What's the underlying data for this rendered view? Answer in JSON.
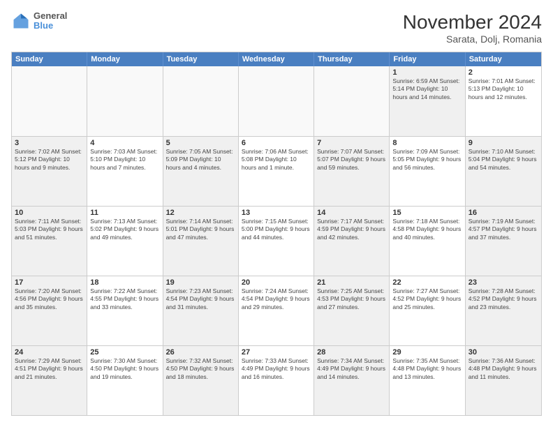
{
  "header": {
    "logo_general": "General",
    "logo_blue": "Blue",
    "title": "November 2024",
    "subtitle": "Sarata, Dolj, Romania"
  },
  "days_of_week": [
    "Sunday",
    "Monday",
    "Tuesday",
    "Wednesday",
    "Thursday",
    "Friday",
    "Saturday"
  ],
  "weeks": [
    [
      {
        "day": "",
        "info": "",
        "empty": true
      },
      {
        "day": "",
        "info": "",
        "empty": true
      },
      {
        "day": "",
        "info": "",
        "empty": true
      },
      {
        "day": "",
        "info": "",
        "empty": true
      },
      {
        "day": "",
        "info": "",
        "empty": true
      },
      {
        "day": "1",
        "info": "Sunrise: 6:59 AM\nSunset: 5:14 PM\nDaylight: 10 hours and 14 minutes.",
        "shaded": true
      },
      {
        "day": "2",
        "info": "Sunrise: 7:01 AM\nSunset: 5:13 PM\nDaylight: 10 hours and 12 minutes.",
        "shaded": false
      }
    ],
    [
      {
        "day": "3",
        "info": "Sunrise: 7:02 AM\nSunset: 5:12 PM\nDaylight: 10 hours and 9 minutes.",
        "shaded": true
      },
      {
        "day": "4",
        "info": "Sunrise: 7:03 AM\nSunset: 5:10 PM\nDaylight: 10 hours and 7 minutes.",
        "shaded": false
      },
      {
        "day": "5",
        "info": "Sunrise: 7:05 AM\nSunset: 5:09 PM\nDaylight: 10 hours and 4 minutes.",
        "shaded": true
      },
      {
        "day": "6",
        "info": "Sunrise: 7:06 AM\nSunset: 5:08 PM\nDaylight: 10 hours and 1 minute.",
        "shaded": false
      },
      {
        "day": "7",
        "info": "Sunrise: 7:07 AM\nSunset: 5:07 PM\nDaylight: 9 hours and 59 minutes.",
        "shaded": true
      },
      {
        "day": "8",
        "info": "Sunrise: 7:09 AM\nSunset: 5:05 PM\nDaylight: 9 hours and 56 minutes.",
        "shaded": false
      },
      {
        "day": "9",
        "info": "Sunrise: 7:10 AM\nSunset: 5:04 PM\nDaylight: 9 hours and 54 minutes.",
        "shaded": true
      }
    ],
    [
      {
        "day": "10",
        "info": "Sunrise: 7:11 AM\nSunset: 5:03 PM\nDaylight: 9 hours and 51 minutes.",
        "shaded": true
      },
      {
        "day": "11",
        "info": "Sunrise: 7:13 AM\nSunset: 5:02 PM\nDaylight: 9 hours and 49 minutes.",
        "shaded": false
      },
      {
        "day": "12",
        "info": "Sunrise: 7:14 AM\nSunset: 5:01 PM\nDaylight: 9 hours and 47 minutes.",
        "shaded": true
      },
      {
        "day": "13",
        "info": "Sunrise: 7:15 AM\nSunset: 5:00 PM\nDaylight: 9 hours and 44 minutes.",
        "shaded": false
      },
      {
        "day": "14",
        "info": "Sunrise: 7:17 AM\nSunset: 4:59 PM\nDaylight: 9 hours and 42 minutes.",
        "shaded": true
      },
      {
        "day": "15",
        "info": "Sunrise: 7:18 AM\nSunset: 4:58 PM\nDaylight: 9 hours and 40 minutes.",
        "shaded": false
      },
      {
        "day": "16",
        "info": "Sunrise: 7:19 AM\nSunset: 4:57 PM\nDaylight: 9 hours and 37 minutes.",
        "shaded": true
      }
    ],
    [
      {
        "day": "17",
        "info": "Sunrise: 7:20 AM\nSunset: 4:56 PM\nDaylight: 9 hours and 35 minutes.",
        "shaded": true
      },
      {
        "day": "18",
        "info": "Sunrise: 7:22 AM\nSunset: 4:55 PM\nDaylight: 9 hours and 33 minutes.",
        "shaded": false
      },
      {
        "day": "19",
        "info": "Sunrise: 7:23 AM\nSunset: 4:54 PM\nDaylight: 9 hours and 31 minutes.",
        "shaded": true
      },
      {
        "day": "20",
        "info": "Sunrise: 7:24 AM\nSunset: 4:54 PM\nDaylight: 9 hours and 29 minutes.",
        "shaded": false
      },
      {
        "day": "21",
        "info": "Sunrise: 7:25 AM\nSunset: 4:53 PM\nDaylight: 9 hours and 27 minutes.",
        "shaded": true
      },
      {
        "day": "22",
        "info": "Sunrise: 7:27 AM\nSunset: 4:52 PM\nDaylight: 9 hours and 25 minutes.",
        "shaded": false
      },
      {
        "day": "23",
        "info": "Sunrise: 7:28 AM\nSunset: 4:52 PM\nDaylight: 9 hours and 23 minutes.",
        "shaded": true
      }
    ],
    [
      {
        "day": "24",
        "info": "Sunrise: 7:29 AM\nSunset: 4:51 PM\nDaylight: 9 hours and 21 minutes.",
        "shaded": true
      },
      {
        "day": "25",
        "info": "Sunrise: 7:30 AM\nSunset: 4:50 PM\nDaylight: 9 hours and 19 minutes.",
        "shaded": false
      },
      {
        "day": "26",
        "info": "Sunrise: 7:32 AM\nSunset: 4:50 PM\nDaylight: 9 hours and 18 minutes.",
        "shaded": true
      },
      {
        "day": "27",
        "info": "Sunrise: 7:33 AM\nSunset: 4:49 PM\nDaylight: 9 hours and 16 minutes.",
        "shaded": false
      },
      {
        "day": "28",
        "info": "Sunrise: 7:34 AM\nSunset: 4:49 PM\nDaylight: 9 hours and 14 minutes.",
        "shaded": true
      },
      {
        "day": "29",
        "info": "Sunrise: 7:35 AM\nSunset: 4:48 PM\nDaylight: 9 hours and 13 minutes.",
        "shaded": false
      },
      {
        "day": "30",
        "info": "Sunrise: 7:36 AM\nSunset: 4:48 PM\nDaylight: 9 hours and 11 minutes.",
        "shaded": true
      }
    ]
  ]
}
